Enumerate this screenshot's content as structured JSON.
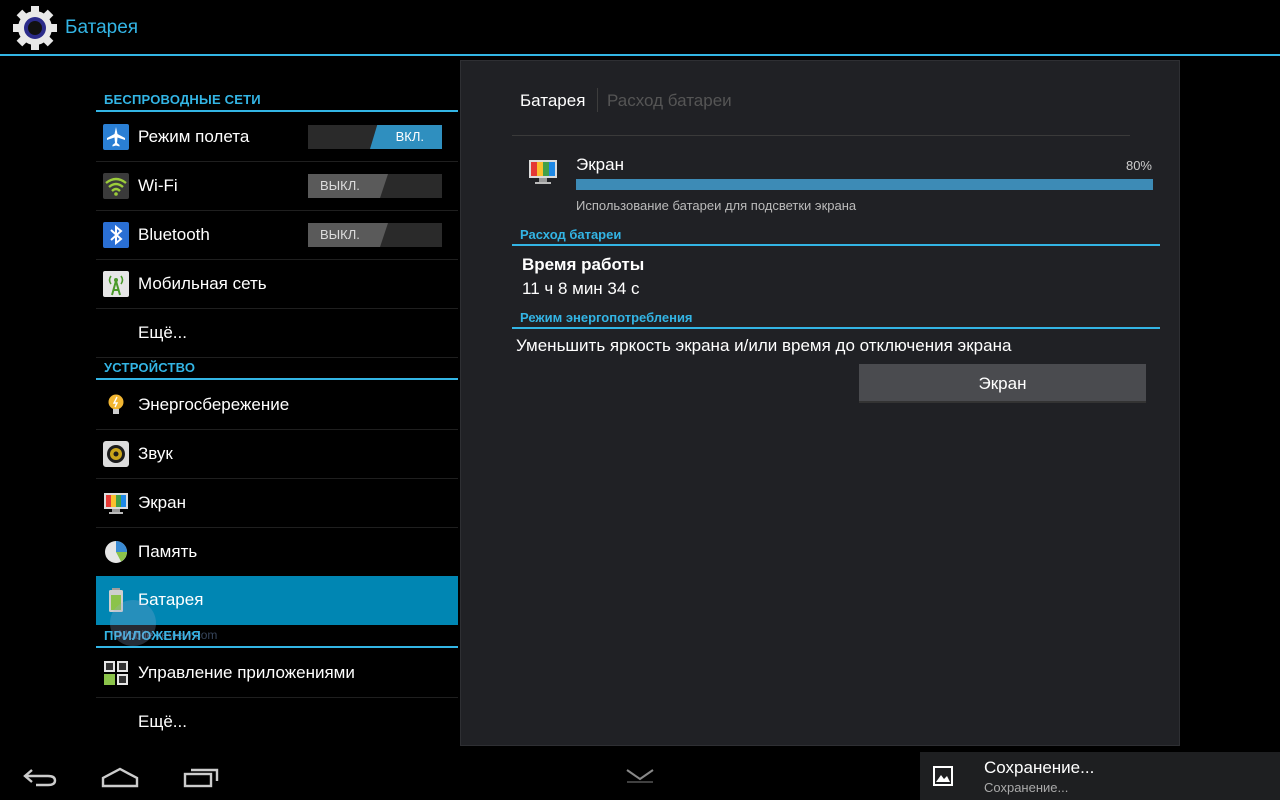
{
  "app": {
    "title": "Батарея",
    "accent": "#33b5e5"
  },
  "sidebar": {
    "sections": [
      {
        "header": "БЕСПРОВОДНЫЕ СЕТИ"
      },
      {
        "header": "УСТРОЙСТВО"
      },
      {
        "header": "ПРИЛОЖЕНИЯ"
      }
    ],
    "items": [
      {
        "label": "Режим полета",
        "icon": "airplane-icon",
        "toggle": "ВКЛ."
      },
      {
        "label": "Wi-Fi",
        "icon": "wifi-icon",
        "toggle": "ВЫКЛ."
      },
      {
        "label": "Bluetooth",
        "icon": "bluetooth-icon",
        "toggle": "ВЫКЛ."
      },
      {
        "label": "Мобильная сеть",
        "icon": "mobile-network-icon"
      },
      {
        "label": "Ещё..."
      },
      {
        "label": "Энергосбережение",
        "icon": "lightbulb-icon"
      },
      {
        "label": "Звук",
        "icon": "speaker-icon"
      },
      {
        "label": "Экран",
        "icon": "display-icon"
      },
      {
        "label": "Память",
        "icon": "storage-pie-icon"
      },
      {
        "label": "Батарея",
        "icon": "battery-icon",
        "selected": true
      },
      {
        "label": "Управление приложениями",
        "icon": "apps-grid-icon"
      },
      {
        "label": "Ещё..."
      }
    ]
  },
  "panel": {
    "tabs": [
      {
        "label": "Батарея",
        "active": true
      },
      {
        "label": "Расход батареи"
      }
    ],
    "usage": {
      "name": "Экран",
      "percent_label": "80%",
      "percent": 100,
      "description": "Использование батареи для подсветки экрана"
    },
    "battery_use_header": "Расход батареи",
    "runtime_label": "Время работы",
    "runtime_value": "11 ч 8 мин 34 с",
    "power_header": "Режим энергопотребления",
    "power_text": "Уменьшить яркость экрана и/или время до отключения экрана",
    "screen_button": "Экран"
  },
  "notification": {
    "title": "Сохранение...",
    "subtitle": "Сохранение...",
    "icon": "image-icon"
  },
  "navbar": {
    "icons": [
      "back-icon",
      "home-icon",
      "recent-apps-icon",
      "collapse-chevron-icon"
    ]
  },
  "watermark": "Mobile-review.com"
}
